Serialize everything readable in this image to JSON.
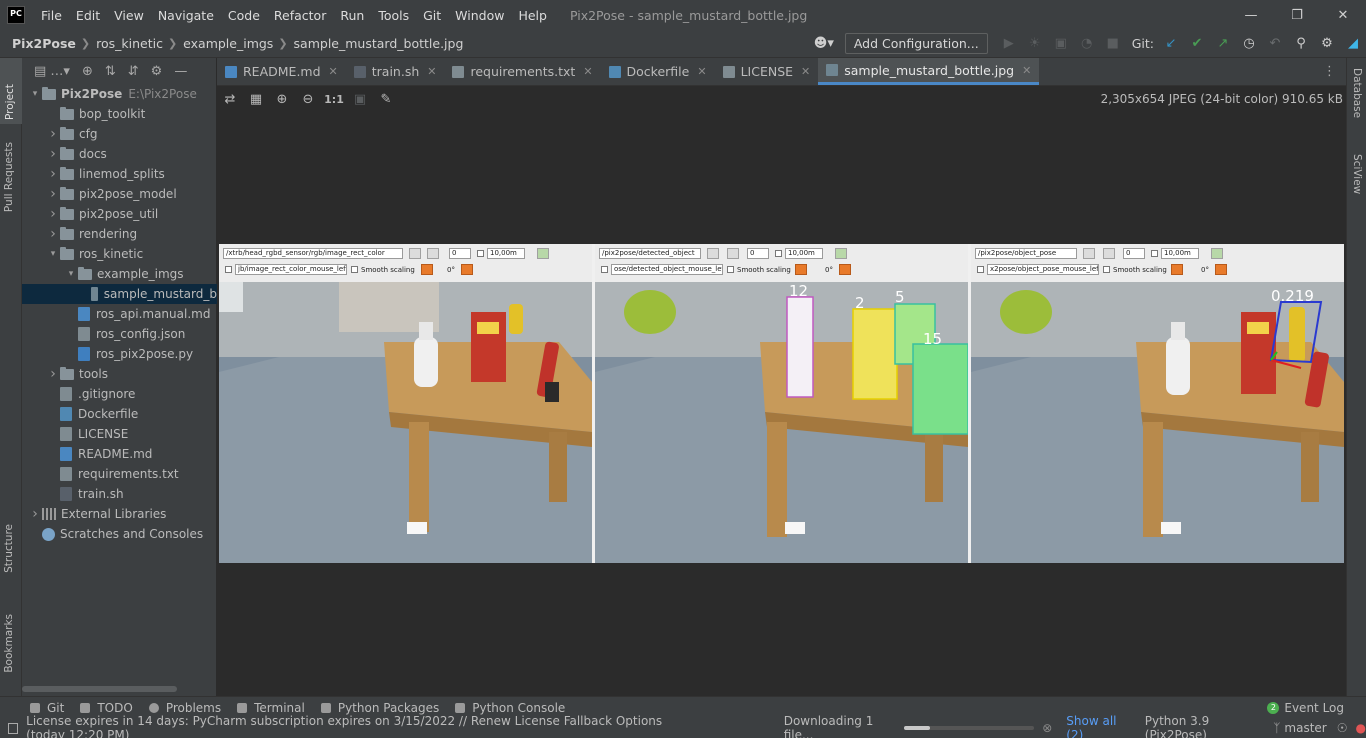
{
  "app": {
    "logo": "PC",
    "menu": [
      "File",
      "Edit",
      "View",
      "Navigate",
      "Code",
      "Refactor",
      "Run",
      "Tools",
      "Git",
      "Window",
      "Help"
    ],
    "window_title": "Pix2Pose - sample_mustard_bottle.jpg"
  },
  "breadcrumb": [
    "Pix2Pose",
    "ros_kinetic",
    "example_imgs",
    "sample_mustard_bottle.jpg"
  ],
  "toolbar": {
    "add_configuration": "Add Configuration...",
    "git_label": "Git:"
  },
  "left_strip": [
    "Project",
    "Pull Requests",
    "Structure",
    "Bookmarks"
  ],
  "right_strip": [
    "Database",
    "SciView"
  ],
  "project_tree": [
    {
      "label": "Pix2Pose",
      "path": "E:\\Pix2Pose",
      "type": "folder",
      "depth": 0,
      "expanded": true
    },
    {
      "label": "bop_toolkit",
      "type": "folder",
      "depth": 1,
      "expanded": null
    },
    {
      "label": "cfg",
      "type": "folder",
      "depth": 1,
      "expanded": false
    },
    {
      "label": "docs",
      "type": "folder",
      "depth": 1,
      "expanded": false
    },
    {
      "label": "linemod_splits",
      "type": "folder",
      "depth": 1,
      "expanded": false
    },
    {
      "label": "pix2pose_model",
      "type": "folder",
      "depth": 1,
      "expanded": false
    },
    {
      "label": "pix2pose_util",
      "type": "folder",
      "depth": 1,
      "expanded": false
    },
    {
      "label": "rendering",
      "type": "folder",
      "depth": 1,
      "expanded": false
    },
    {
      "label": "ros_kinetic",
      "type": "folder",
      "depth": 1,
      "expanded": true
    },
    {
      "label": "example_imgs",
      "type": "folder",
      "depth": 2,
      "expanded": true
    },
    {
      "label": "sample_mustard_b",
      "type": "img",
      "depth": 3,
      "selected": true
    },
    {
      "label": "ros_api.manual.md",
      "type": "md",
      "depth": 2
    },
    {
      "label": "ros_config.json",
      "type": "txt",
      "depth": 2
    },
    {
      "label": "ros_pix2pose.py",
      "type": "py",
      "depth": 2
    },
    {
      "label": "tools",
      "type": "folder",
      "depth": 1,
      "expanded": false
    },
    {
      "label": ".gitignore",
      "type": "txt",
      "depth": 1
    },
    {
      "label": "Dockerfile",
      "type": "docker",
      "depth": 1
    },
    {
      "label": "LICENSE",
      "type": "txt",
      "depth": 1
    },
    {
      "label": "README.md",
      "type": "md",
      "depth": 1
    },
    {
      "label": "requirements.txt",
      "type": "txt",
      "depth": 1
    },
    {
      "label": "train.sh",
      "type": "sh",
      "depth": 1
    },
    {
      "label": "External Libraries",
      "type": "lib",
      "depth": 0,
      "expanded": false
    },
    {
      "label": "Scratches and Consoles",
      "type": "scratch",
      "depth": 0
    }
  ],
  "tabs": [
    {
      "label": "README.md",
      "icon": "md",
      "active": false
    },
    {
      "label": "train.sh",
      "icon": "sh",
      "active": false
    },
    {
      "label": "requirements.txt",
      "icon": "txt",
      "active": false
    },
    {
      "label": "Dockerfile",
      "icon": "docker",
      "active": false
    },
    {
      "label": "LICENSE",
      "icon": "txt",
      "active": false
    },
    {
      "label": "sample_mustard_bottle.jpg",
      "icon": "img",
      "active": true
    }
  ],
  "image_info": "2,305x654 JPEG (24-bit color) 910.65 kB",
  "image_toolbar": {
    "actual_size": "1:1"
  },
  "panes": [
    {
      "topic": "/xtrb/head_rgbd_sensor/rgb/image_rect_color",
      "mouse_topic": "jb/image_rect_color_mouse_left",
      "value": "0",
      "zoom": "10,00m",
      "smooth": "Smooth scaling",
      "rotation": "0°",
      "labels": []
    },
    {
      "topic": "/pix2pose/detected_object",
      "mouse_topic": "ose/detected_object_mouse_left",
      "value": "0",
      "zoom": "10,00m",
      "smooth": "Smooth scaling",
      "rotation": "0°",
      "labels": [
        "12",
        "2",
        "5",
        "15"
      ]
    },
    {
      "topic": "/pix2pose/object_pose",
      "mouse_topic": "x2pose/object_pose_mouse_left",
      "value": "0",
      "zoom": "10,00m",
      "smooth": "Smooth scaling",
      "rotation": "0°",
      "labels": [
        "0.219"
      ]
    }
  ],
  "toolwindows": [
    "Git",
    "TODO",
    "Problems",
    "Terminal",
    "Python Packages",
    "Python Console"
  ],
  "event_log": {
    "count": "2",
    "label": "Event Log"
  },
  "status": {
    "message": "License expires in 14 days: PyCharm subscription expires on 3/15/2022 // Renew License   Fallback Options (today 12:20 PM)",
    "download": "Downloading 1 file...",
    "download_progress": 0.2,
    "show_all": "Show all (2)",
    "interpreter": "Python 3.9 (Pix2Pose)",
    "branch": "master"
  }
}
